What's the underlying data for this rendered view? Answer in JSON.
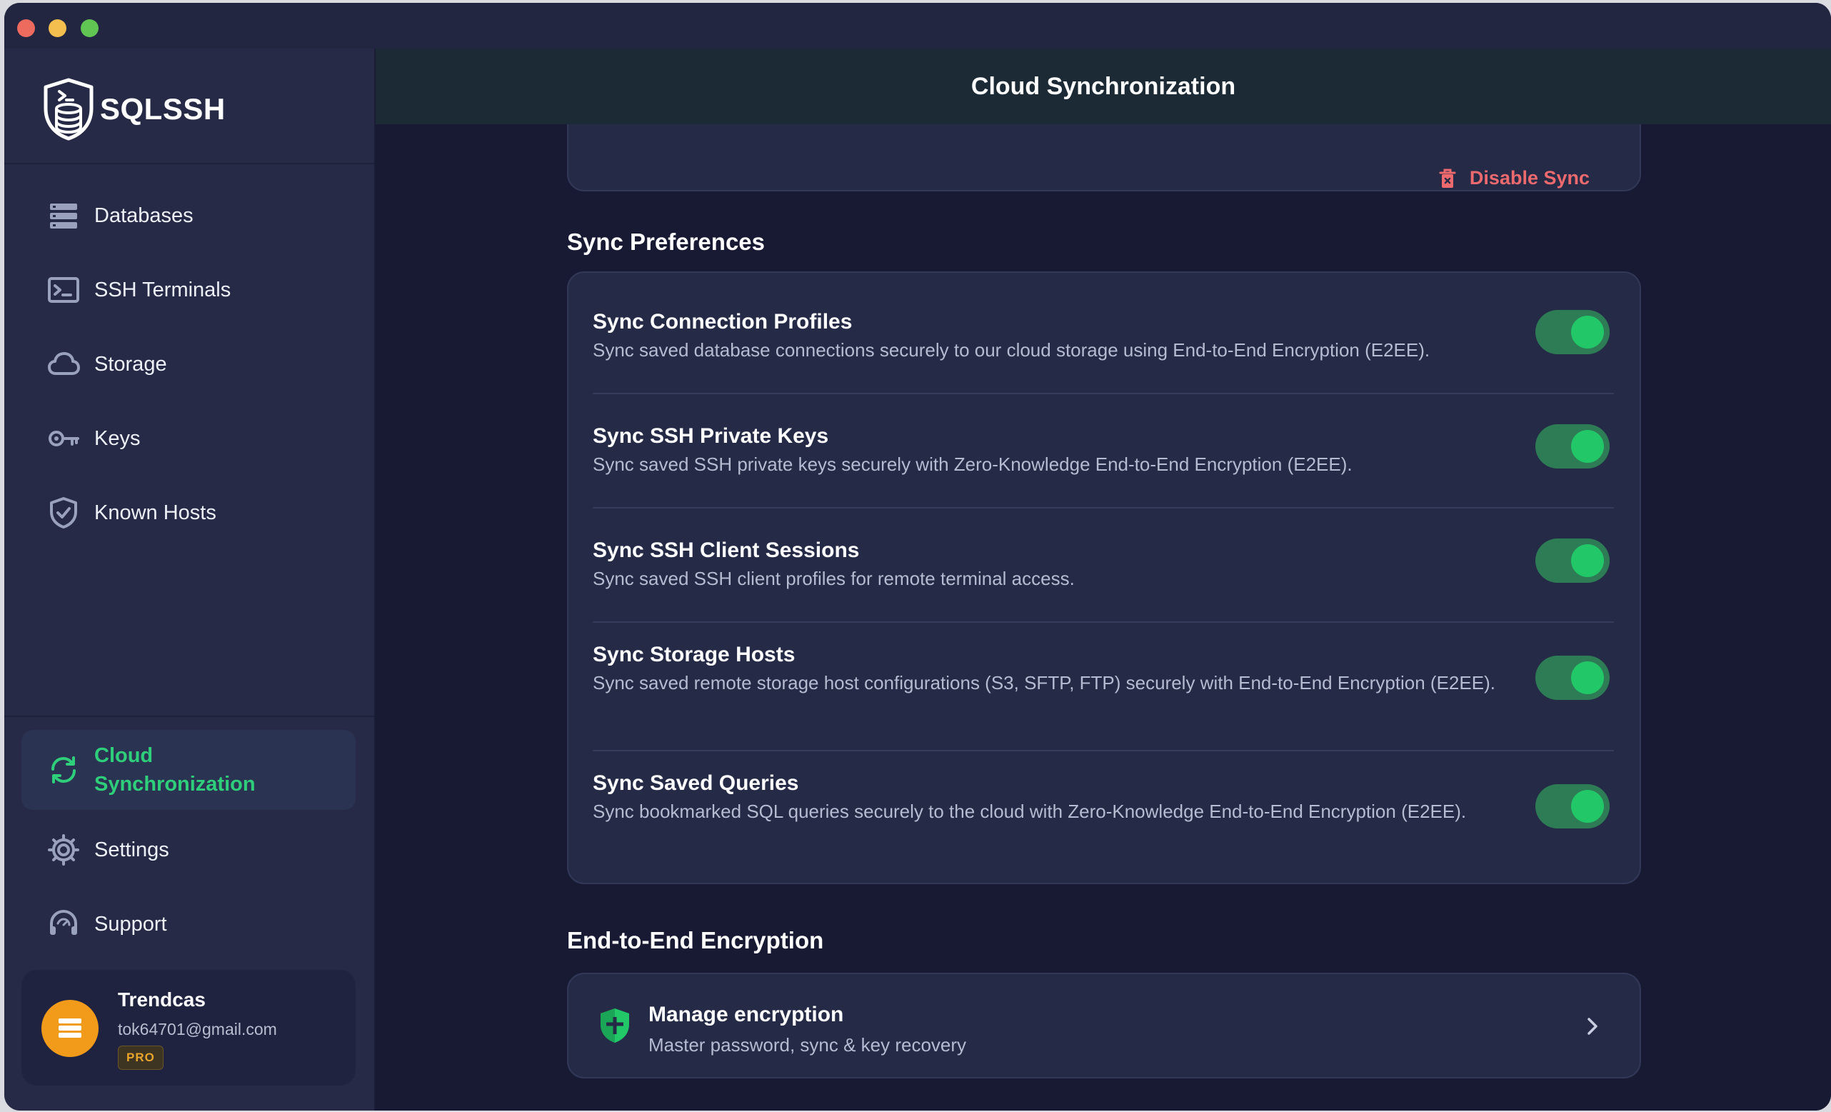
{
  "app": {
    "name": "SQLSSH"
  },
  "sidebar": {
    "items": [
      {
        "label": "Databases",
        "icon": "database-icon"
      },
      {
        "label": "SSH Terminals",
        "icon": "terminal-icon"
      },
      {
        "label": "Storage",
        "icon": "cloud-icon"
      },
      {
        "label": "Keys",
        "icon": "key-icon"
      },
      {
        "label": "Known Hosts",
        "icon": "shield-check-icon"
      }
    ],
    "bottom_items": [
      {
        "label": "Cloud Synchronization",
        "icon": "sync-icon",
        "active": true
      },
      {
        "label": "Settings",
        "icon": "gear-icon"
      },
      {
        "label": "Support",
        "icon": "headset-icon"
      }
    ],
    "profile": {
      "name": "Trendcas",
      "email": "tok64701@gmail.com",
      "badge": "PRO"
    }
  },
  "main": {
    "title": "Cloud Synchronization",
    "disable_sync_label": "Disable Sync",
    "preferences": {
      "title": "Sync Preferences",
      "items": [
        {
          "title": "Sync Connection Profiles",
          "desc": "Sync saved database connections securely to our cloud storage using End-to-End Encryption (E2EE).",
          "enabled": true
        },
        {
          "title": "Sync SSH Private Keys",
          "desc": "Sync saved SSH private keys securely with Zero-Knowledge End-to-End Encryption (E2EE).",
          "enabled": true
        },
        {
          "title": "Sync SSH Client Sessions",
          "desc": "Sync saved SSH client profiles for remote terminal access.",
          "enabled": true
        },
        {
          "title": "Sync Storage Hosts",
          "desc": "Sync saved remote storage host configurations (S3, SFTP, FTP) securely with End-to-End Encryption (E2EE).",
          "enabled": true
        },
        {
          "title": "Sync Saved Queries",
          "desc": "Sync bookmarked SQL queries securely to the cloud with Zero-Knowledge End-to-End Encryption (E2EE).",
          "enabled": true
        }
      ]
    },
    "encryption": {
      "section_title": "End-to-End Encryption",
      "item_title": "Manage encryption",
      "item_desc": "Master password, sync & key recovery"
    }
  },
  "colors": {
    "accent_green": "#22c767",
    "danger": "#ec6a6e",
    "pro_badge": "#e8a52c",
    "avatar": "#f29a1a"
  }
}
